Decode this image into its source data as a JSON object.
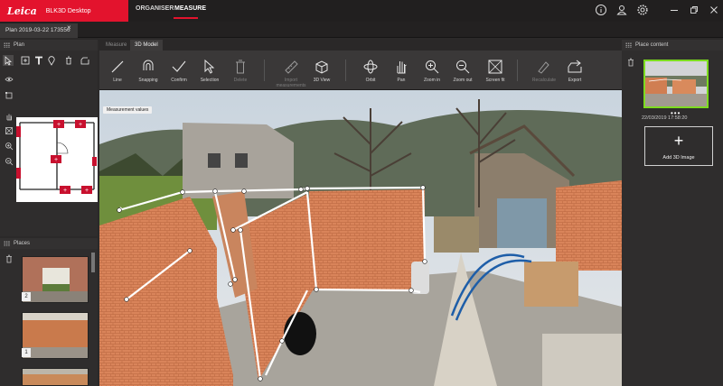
{
  "app": {
    "logo_text": "Leica",
    "name": "BLK3D Desktop",
    "nav": {
      "organiser": "ORGANISER",
      "measure": "MEASURE"
    },
    "accent_color": "#e3132d",
    "top_icons": [
      "info-icon",
      "user-icon",
      "settings-icon"
    ],
    "window_controls": [
      "minimize-icon",
      "restore-icon",
      "close-icon"
    ]
  },
  "document_tab": {
    "title": "Plan 2019-03-22 173556",
    "close": "×"
  },
  "plan_panel": {
    "title": "Plan",
    "tools": [
      "select-arrow-icon",
      "add-area-icon",
      "text-icon",
      "pin-icon",
      "delete-icon",
      "export-icon"
    ],
    "side_tools": [
      "eye-icon",
      "crop-icon",
      "pan-hand-icon",
      "fit-screen-icon",
      "zoom-in-icon",
      "zoom-out-icon"
    ],
    "marker_symbol": "+"
  },
  "places_panel": {
    "title": "Places",
    "items": [
      {
        "number": "2"
      },
      {
        "number": "1"
      },
      {
        "number": ""
      }
    ]
  },
  "center_tabs": {
    "measure": "Measure",
    "model": "3D Model"
  },
  "toolbar": {
    "line": "Line",
    "snapping": "Snapping",
    "confirm": "Confirm",
    "selection": "Selection",
    "delete": "Delete",
    "import_measurements": "Import measurements",
    "view_3d": "3D View",
    "orbit": "Orbit",
    "pan": "Pan",
    "zoom_in": "Zoom in",
    "zoom_out": "Zoom out",
    "screen_fit": "Screen fit",
    "recalculate": "Recalculate",
    "export": "Export"
  },
  "viewport": {
    "badge": "Measurement values"
  },
  "place_content": {
    "title": "Place content",
    "thumb_more": "•••",
    "thumb_date": "22/03/2019 17:58:20",
    "add_symbol": "+",
    "add_label": "Add 3D Image",
    "selected_color": "#7ddc1f"
  }
}
